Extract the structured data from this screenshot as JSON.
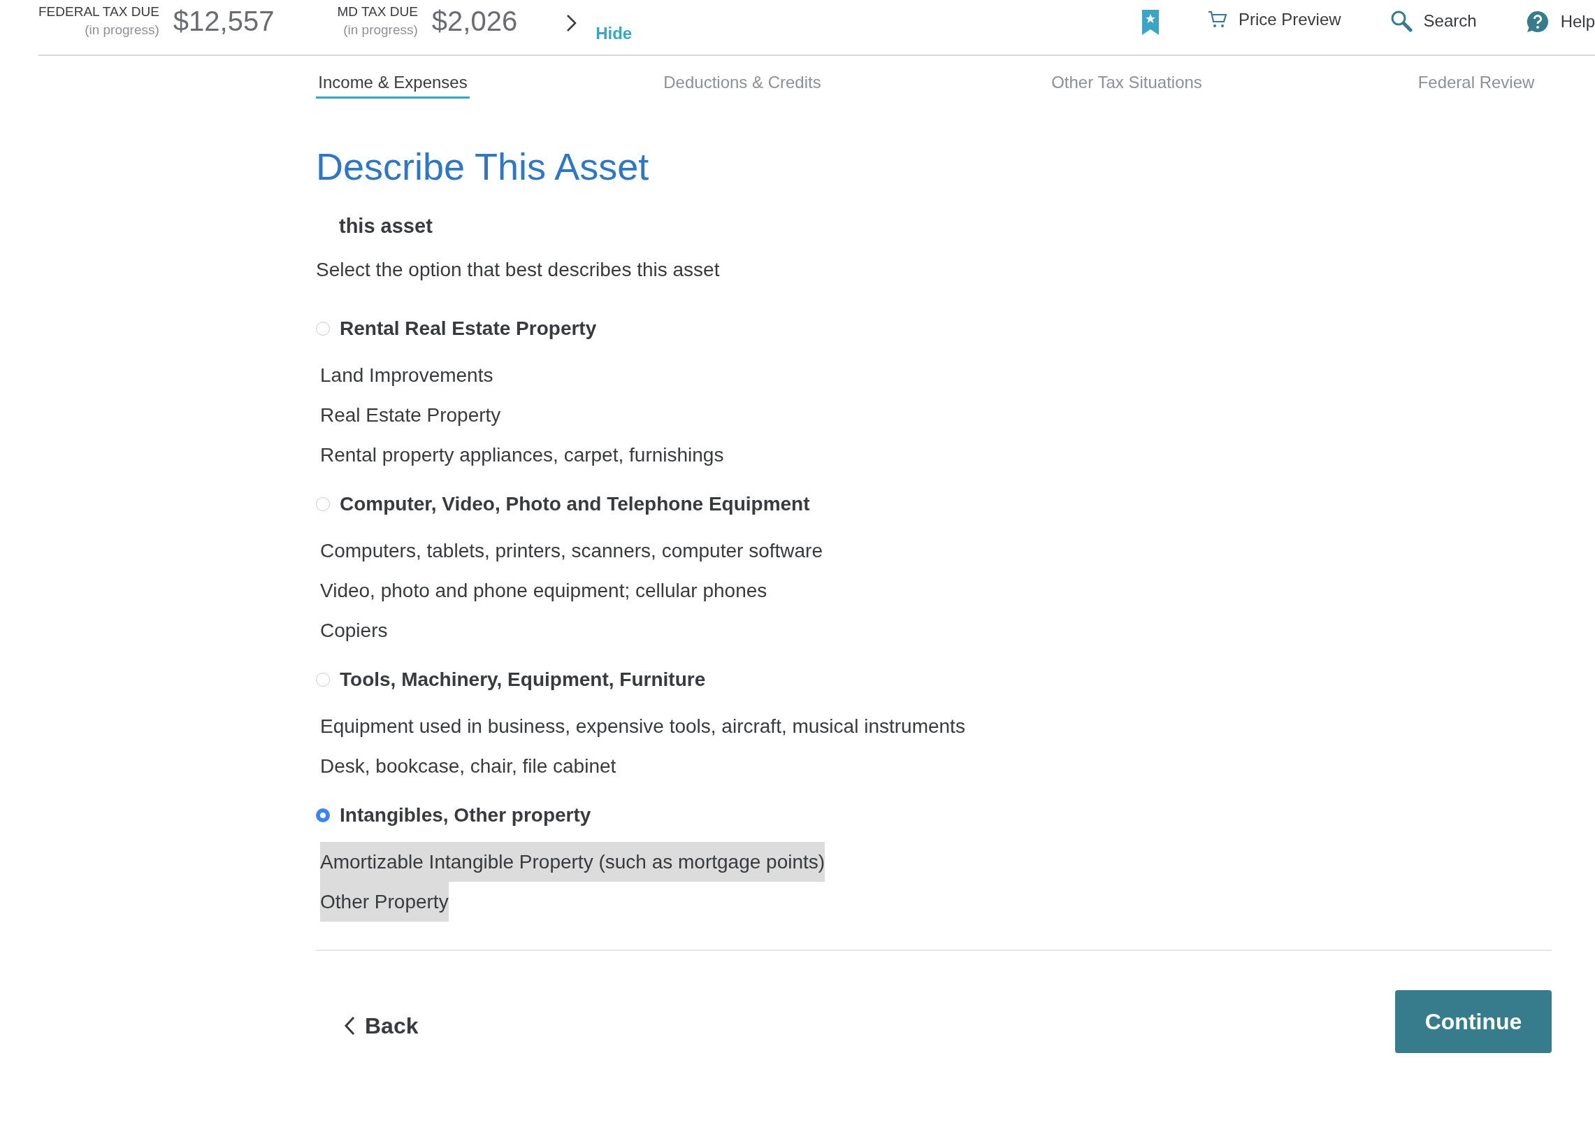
{
  "header": {
    "taxes": [
      {
        "label": "FEDERAL TAX DUE",
        "status": "(in progress)",
        "amount": "$12,557"
      },
      {
        "label": "MD TAX DUE",
        "status": "(in progress)",
        "amount": "$2,026"
      }
    ],
    "hide_link": "Hide",
    "actions": [
      {
        "kind": "bookmark"
      },
      {
        "kind": "cart",
        "label": "Price Preview"
      },
      {
        "kind": "search",
        "label": "Search"
      },
      {
        "kind": "help",
        "label": "Help"
      }
    ]
  },
  "tabs": [
    {
      "label": "Income & Expenses",
      "selected": true
    },
    {
      "label": "Deductions & Credits",
      "selected": false
    },
    {
      "label": "Other Tax Situations",
      "selected": false
    },
    {
      "label": "Federal Review",
      "selected": false
    }
  ],
  "title": "Describe This Asset",
  "subtitle": "this asset",
  "instruction": "Select the option that best describes this asset",
  "options": [
    {
      "label": "Rental Real Estate Property",
      "selected": false,
      "items": [
        "Land Improvements",
        "Real Estate Property",
        "Rental property appliances, carpet, furnishings"
      ]
    },
    {
      "label": "Computer, Video, Photo and Telephone Equipment",
      "selected": false,
      "items": [
        "Computers, tablets, printers, scanners, computer software",
        "Video, photo and phone equipment; cellular phones",
        "Copiers"
      ]
    },
    {
      "label": "Tools, Machinery, Equipment, Furniture",
      "selected": false,
      "items": [
        "Equipment used in business, expensive tools, aircraft, musical instruments",
        "Desk, bookcase, chair, file cabinet"
      ]
    },
    {
      "label": "Intangibles, Other property",
      "selected": true,
      "items": [
        "Amortizable Intangible Property (such as mortgage points)",
        "Other Property"
      ]
    }
  ],
  "back_button": "Back",
  "continue_button": "Continue"
}
